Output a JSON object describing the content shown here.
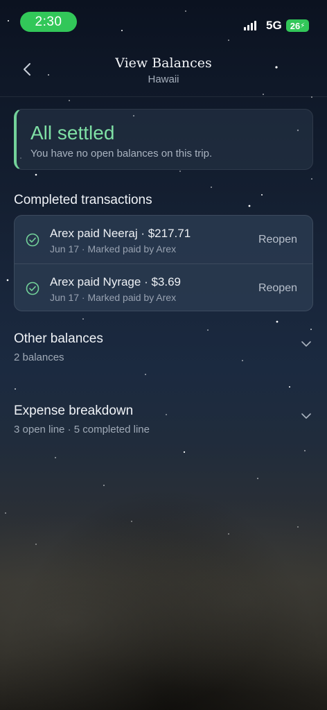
{
  "status_bar": {
    "time": "2:30",
    "network": "5G",
    "battery": "26"
  },
  "header": {
    "title": "View Balances",
    "subtitle": "Hawaii"
  },
  "settled": {
    "title": "All settled",
    "description": "You have no open balances on this trip."
  },
  "completed": {
    "heading": "Completed transactions",
    "items": [
      {
        "title": "Arex paid Neeraj · $217.71",
        "meta": "Jun 17 · Marked paid by Arex",
        "action": "Reopen"
      },
      {
        "title": "Arex paid Nyrage · $3.69",
        "meta": "Jun 17 · Marked paid by Arex",
        "action": "Reopen"
      }
    ]
  },
  "other_balances": {
    "title": "Other balances",
    "subtitle": "2 balances"
  },
  "expense_breakdown": {
    "title": "Expense breakdown",
    "subtitle": "3 open line · 5 completed line"
  },
  "icons": {
    "back": "chevron-left-icon",
    "check": "check-circle-icon",
    "expand": "chevron-down-icon"
  },
  "colors": {
    "accent_green": "#73d29a",
    "status_green": "#32c759"
  }
}
